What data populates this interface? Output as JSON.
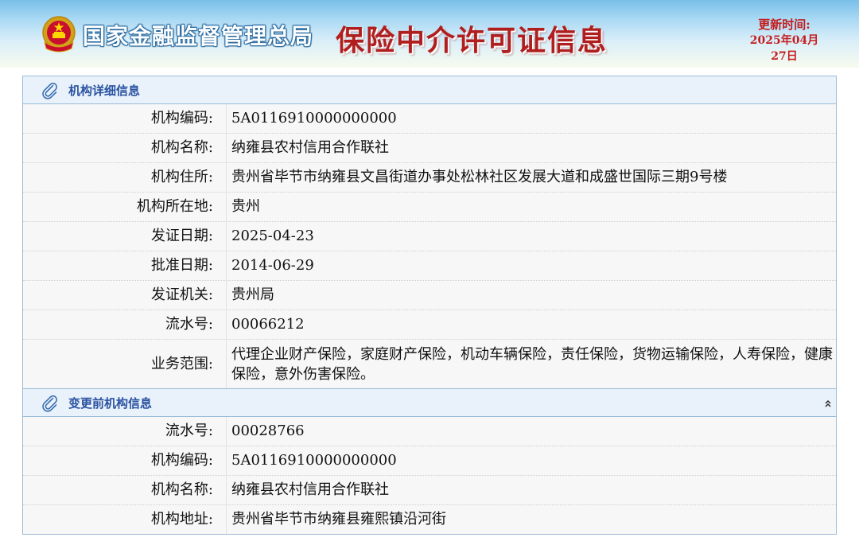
{
  "header": {
    "agency_name": "国家金融监督管理总局",
    "system_title": "保险中介许可证信息",
    "update_label": "更新时间:",
    "update_date": "2025年04月27日",
    "emblem_icon": "national-emblem-icon"
  },
  "colors": {
    "title_red": "#b01e1e",
    "panel_title_blue": "#2a52a0",
    "panel_border": "#9bbcd8",
    "panel_header_bg": "#e9f2fb"
  },
  "detail": {
    "title": "机构详细信息",
    "icon": "paperclip-icon",
    "rows": [
      {
        "label": "机构编码:",
        "value": "5A0116910000000000"
      },
      {
        "label": "机构名称:",
        "value": "纳雍县农村信用合作联社"
      },
      {
        "label": "机构住所:",
        "value": "贵州省毕节市纳雍县文昌街道办事处松林社区发展大道和成盛世国际三期9号楼"
      },
      {
        "label": "机构所在地:",
        "value": "贵州"
      },
      {
        "label": "发证日期:",
        "value": "2025-04-23"
      },
      {
        "label": "批准日期:",
        "value": "2014-06-29"
      },
      {
        "label": "发证机关:",
        "value": "贵州局"
      },
      {
        "label": "流水号:",
        "value": "00066212"
      },
      {
        "label": "业务范围:",
        "value": "代理企业财产保险，家庭财产保险，机动车辆保险，责任保险，货物运输保险，人寿保险，健康保险，意外伤害保险。"
      }
    ]
  },
  "before_change": {
    "title": "变更前机构信息",
    "icon": "paperclip-icon",
    "collapse_icon": "double-chevron-up-icon",
    "rows": [
      {
        "label": "流水号:",
        "value": "00028766"
      },
      {
        "label": "机构编码:",
        "value": "5A0116910000000000"
      },
      {
        "label": "机构名称:",
        "value": "纳雍县农村信用合作联社"
      },
      {
        "label": "机构地址:",
        "value": "贵州省毕节市纳雍县雍熙镇沿河街"
      }
    ]
  }
}
